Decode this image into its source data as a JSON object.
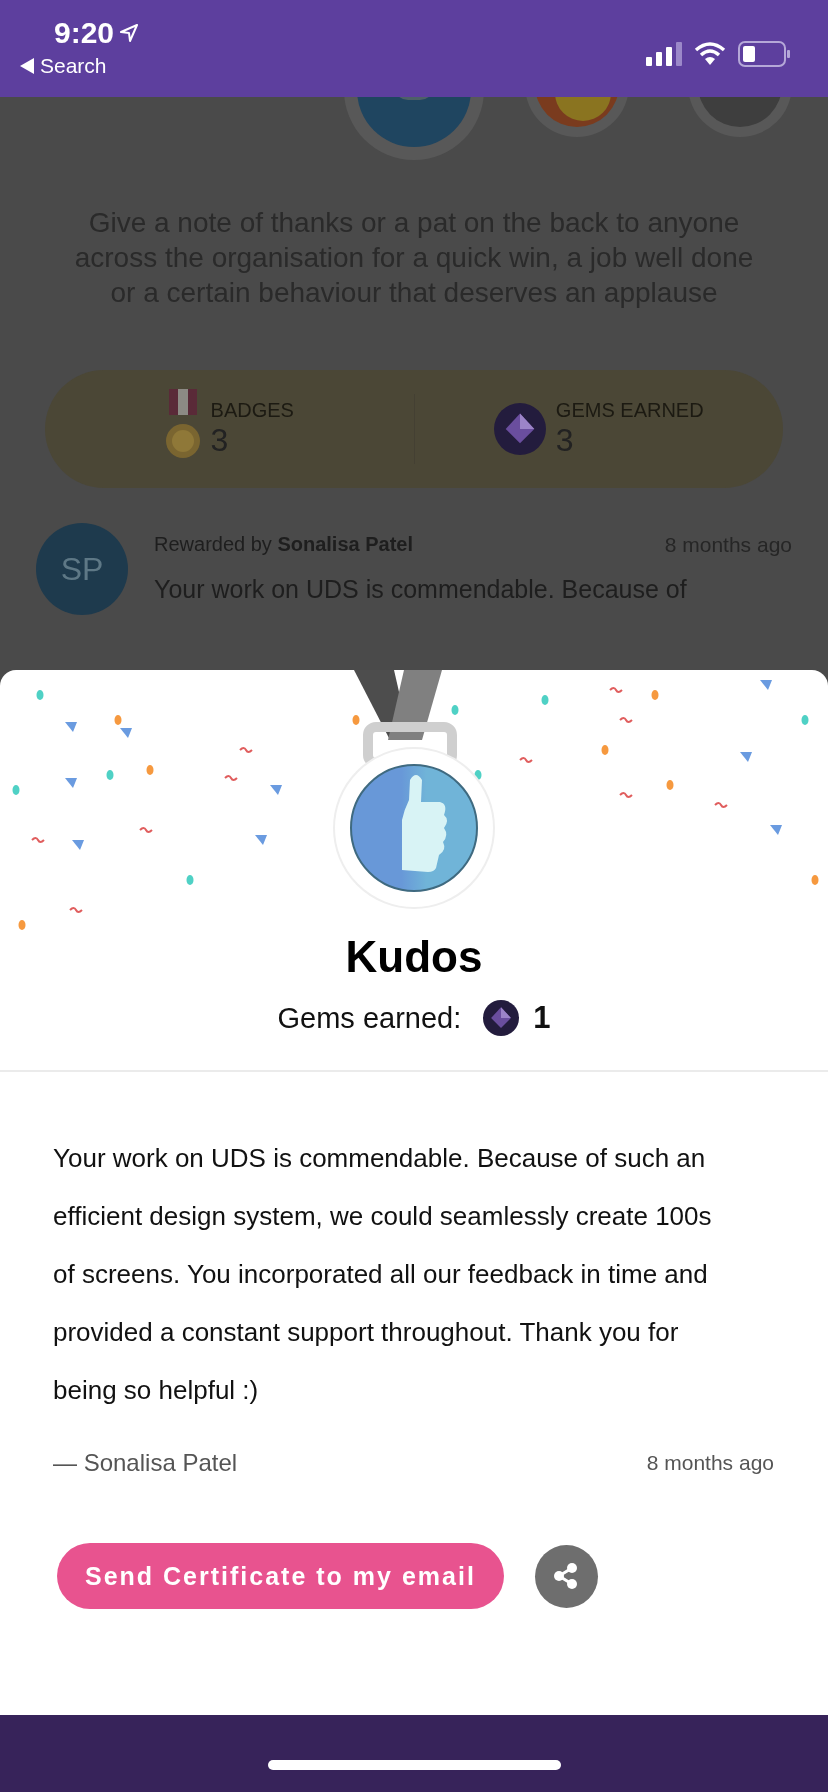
{
  "status_bar": {
    "time": "9:20",
    "back_link": "Search"
  },
  "background": {
    "description": "Give a note of thanks or a pat on the back to anyone across the organisation for a quick win, a job well done or a certain behaviour that deserves an applause",
    "stats": [
      {
        "kind": "badges",
        "label": "BADGES",
        "value": "3"
      },
      {
        "kind": "gems",
        "label": "GEMS EARNED",
        "value": "3"
      }
    ],
    "reward": {
      "avatar": "SP",
      "rewarded_by": "Rewarded by **Sonalisa Patel**",
      "time": "8 months ago",
      "message": "Your work on UDS is commendable. Because of"
    }
  },
  "modal": {
    "title": "Kudos",
    "gems_label": "Gems earned:",
    "gems_value": "1",
    "message": "Your work on UDS is commendable. Because of such an efficient design system, we could seamlessly create 100s of screens. You incorporated all our feedback in time and provided a constant support throughout. Thank you for being so helpful :)",
    "author": "— Sonalisa Patel",
    "time": "8 months ago",
    "button": "Send Certificate to my email"
  }
}
